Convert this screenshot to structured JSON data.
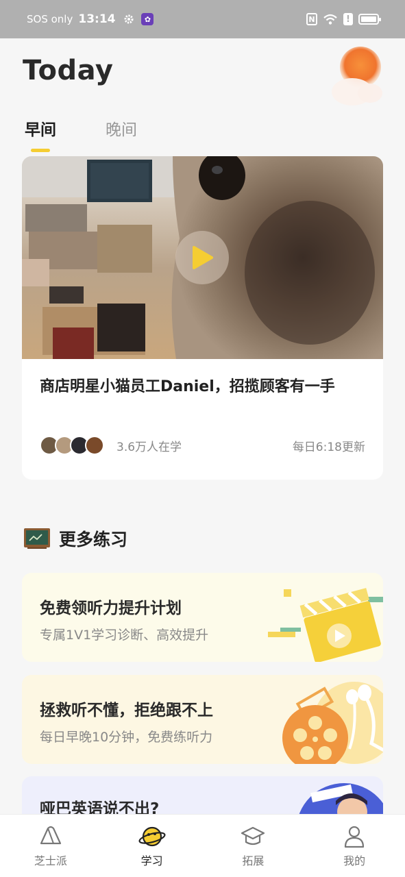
{
  "status_bar": {
    "carrier": "SOS only",
    "time": "13:14",
    "nfc": "N",
    "alert": "!"
  },
  "header": {
    "title": "Today"
  },
  "tabs": [
    {
      "label": "早间",
      "active": true
    },
    {
      "label": "晚间",
      "active": false
    }
  ],
  "video_card": {
    "title": "商店明星小猫员工Daniel，招揽顾客有一手",
    "learners": "3.6万人在学",
    "update": "每日6:18更新"
  },
  "more_practice": {
    "title": "更多练习",
    "items": [
      {
        "title": "免费领听力提升计划",
        "subtitle": "专属1V1学习诊断、高效提升"
      },
      {
        "title": "拯救听不懂，拒绝跟不上",
        "subtitle": "每日早晚10分钟，免费练听力"
      },
      {
        "title": "哑巴英语说不出?",
        "subtitle": ""
      }
    ]
  },
  "bottom_nav": [
    {
      "label": "芝士派",
      "icon": "cheese-icon",
      "active": false
    },
    {
      "label": "学习",
      "icon": "planet-icon",
      "active": true
    },
    {
      "label": "拓展",
      "icon": "graduation-cap-icon",
      "active": false
    },
    {
      "label": "我的",
      "icon": "user-icon",
      "active": false
    }
  ],
  "colors": {
    "accent": "#f5cd32",
    "status_bar": "#b0b0b0",
    "background": "#f6f6f6"
  }
}
